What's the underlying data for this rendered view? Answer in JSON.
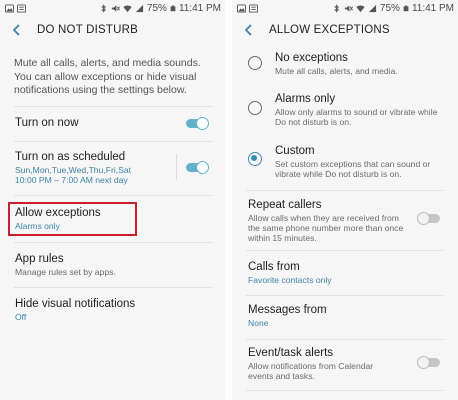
{
  "status_bar": {
    "battery": "75%",
    "time": "11:41 PM"
  },
  "left": {
    "title": "DO NOT DISTURB",
    "intro": "Mute all calls, alerts, and media sounds. You can allow exceptions or hide visual notifications using the settings below.",
    "items": [
      {
        "label": "Turn on now",
        "toggle": "on"
      },
      {
        "label": "Turn on as scheduled",
        "sub_line1": "Sun,Mon,Tue,Wed,Thu,Fri,Sat",
        "sub_line2": "10:00 PM – 7:00 AM next day",
        "toggle": "on"
      },
      {
        "label": "Allow exceptions",
        "sub": "Alarms only"
      },
      {
        "label": "App rules",
        "sub": "Manage rules set by apps."
      },
      {
        "label": "Hide visual notifications",
        "sub": "Off"
      }
    ],
    "accent_color": "#3d84a8",
    "highlight_color": "#c8202a"
  },
  "right": {
    "title": "ALLOW EXCEPTIONS",
    "options": [
      {
        "label": "No exceptions",
        "sub": "Mute all calls, alerts, and media.",
        "checked": false
      },
      {
        "label": "Alarms only",
        "sub_line1": "Allow only alarms to sound or vibrate while",
        "sub_line2": "Do not disturb is on.",
        "checked": false
      },
      {
        "label": "Custom",
        "sub_line1": "Set custom exceptions that can sound or",
        "sub_line2": "vibrate while Do not disturb is on.",
        "checked": true
      }
    ],
    "settings": [
      {
        "label": "Repeat callers",
        "sub_line1": "Allow calls when they are received from",
        "sub_line2": "the same phone number more than once",
        "sub_line3": "within 15 minutes.",
        "toggle": "off"
      },
      {
        "label": "Calls from",
        "sub": "Favorite contacts only"
      },
      {
        "label": "Messages from",
        "sub": "None"
      },
      {
        "label": "Event/task alerts",
        "sub_line1": "Allow notifications from Calendar",
        "sub_line2": "events and tasks.",
        "toggle": "off"
      }
    ]
  }
}
